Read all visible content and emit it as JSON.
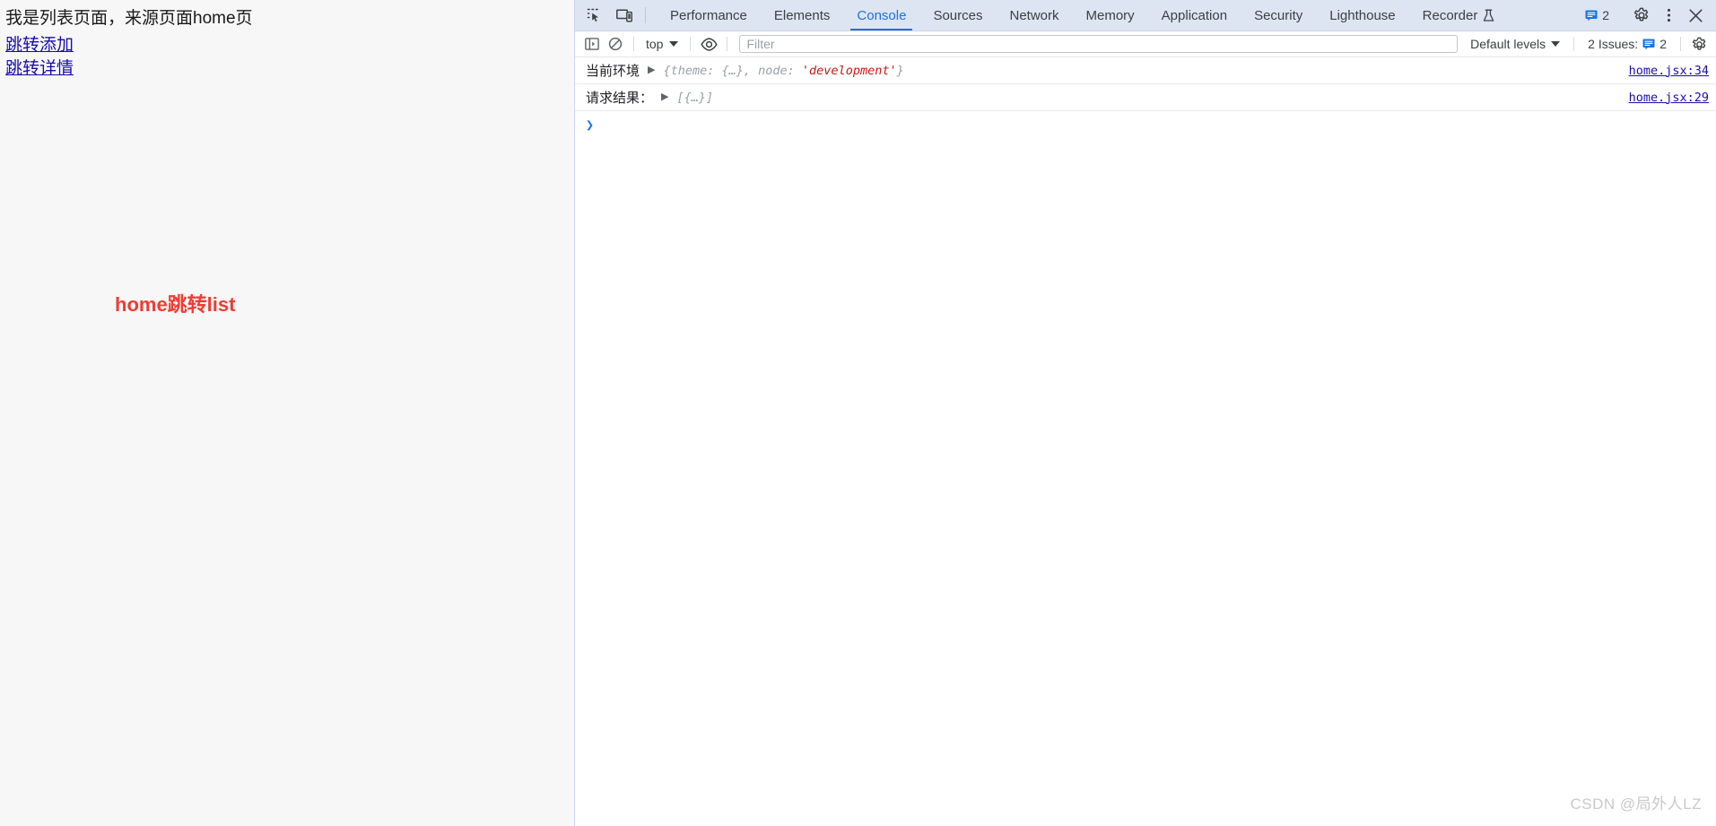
{
  "webpage": {
    "heading": "我是列表页面，来源页面home页",
    "links": [
      {
        "label": "跳转添加",
        "name": "link-jump-add"
      },
      {
        "label": "跳转详情",
        "name": "link-jump-detail"
      }
    ],
    "center_text": "home跳转list",
    "center_text_color": "#f03c33",
    "link_color": "#1a0dab",
    "background": "#f7f7f7"
  },
  "devtools": {
    "tabs": [
      {
        "label": "Performance",
        "active": false
      },
      {
        "label": "Elements",
        "active": false
      },
      {
        "label": "Console",
        "active": true
      },
      {
        "label": "Sources",
        "active": false
      },
      {
        "label": "Network",
        "active": false
      },
      {
        "label": "Memory",
        "active": false
      },
      {
        "label": "Application",
        "active": false
      },
      {
        "label": "Security",
        "active": false
      },
      {
        "label": "Lighthouse",
        "active": false
      },
      {
        "label": "Recorder",
        "active": false,
        "experimental": true
      }
    ],
    "active_tab": "Console",
    "accent_color": "#1a73e8",
    "header_background": "#dee5f2",
    "toolbar_icons": {
      "inspect": "inspect-element-icon",
      "device": "device-toolbar-icon",
      "settings": "gear-icon",
      "more": "more-options-icon",
      "close": "close-icon"
    },
    "issues_badge_count": "2",
    "console": {
      "sidebar_toggle": "console-sidebar-icon",
      "clear": "clear-console-icon",
      "context": "top",
      "live_expression": "eye-icon",
      "filter_placeholder": "Filter",
      "filter_value": "",
      "levels": "Default levels",
      "issues_label": "2 Issues:",
      "issues_count": "2",
      "settings": "gear-icon",
      "prompt_caret": "❯",
      "messages": [
        {
          "label": "当前环境",
          "preview_pre": "{theme: {…}, node: ",
          "preview_str": "'development'",
          "preview_post": "}",
          "source": "home.jsx:34"
        },
        {
          "label": "请求结果：",
          "preview_pre": "[{…}]",
          "preview_str": "",
          "preview_post": "",
          "source": "home.jsx:29"
        }
      ]
    }
  },
  "watermark": "CSDN @局外人LZ"
}
